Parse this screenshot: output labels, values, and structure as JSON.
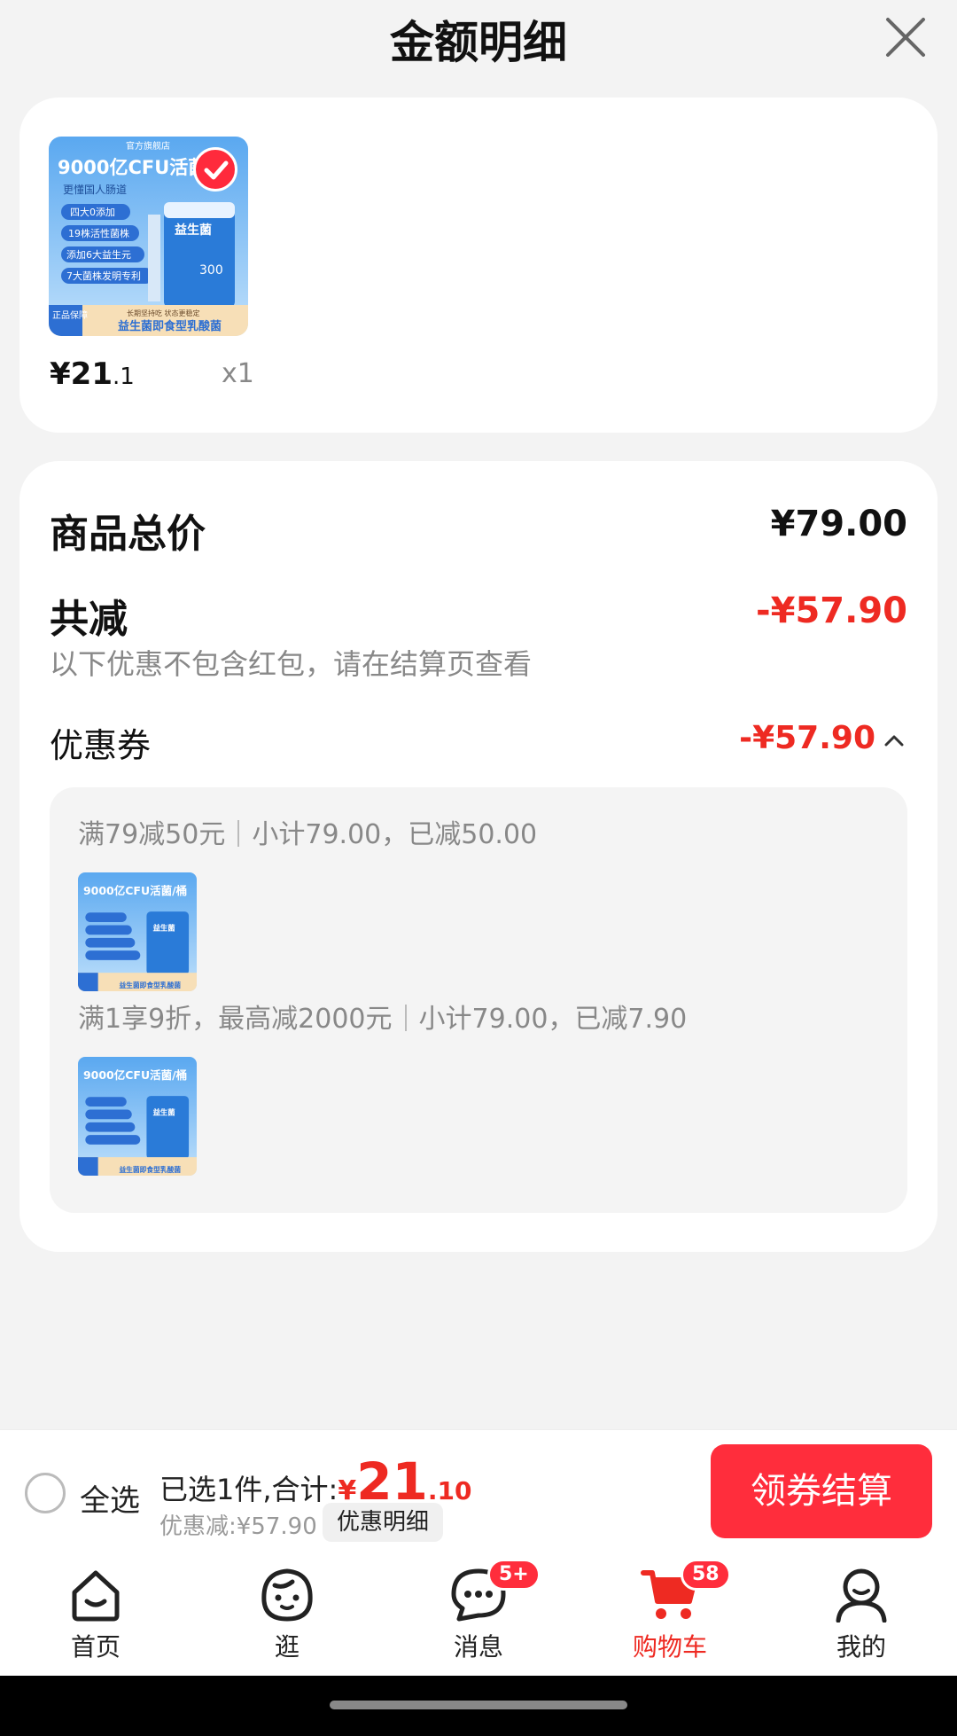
{
  "header": {
    "title": "金额明细"
  },
  "product": {
    "price_int": "¥21",
    "price_dec": ".1",
    "qty": "x1",
    "img": {
      "brand": "官方旗舰店",
      "headline": "9000亿CFU活菌/桶",
      "sub": "更懂国人肠道",
      "pills": [
        "四大0添加",
        "19株活性菌株",
        "添加6大益生元",
        "7大菌株发明专利"
      ],
      "can_text": "益生菌",
      "can_num": "300",
      "tag": "正品保障",
      "footer_small": "长期坚持吃 状态更稳定",
      "footer": "益生菌即食型乳酸菌"
    }
  },
  "summary": {
    "total_label": "商品总价",
    "total_value": "¥79.00",
    "reduce_label": "共减",
    "reduce_value": "-¥57.90",
    "note": "以下优惠不包含红包，请在结算页查看",
    "coupon_label": "优惠券",
    "coupon_value": "-¥57.90",
    "coupons": [
      {
        "rule": "满79减50元",
        "detail": "小计79.00，已减50.00"
      },
      {
        "rule": "满1享9折，最高减2000元",
        "detail": "小计79.00，已减7.90"
      }
    ]
  },
  "checkout": {
    "select_all": "全选",
    "selected_prefix": "已选1件,合计:",
    "currency": "¥",
    "total_int": "21",
    "total_dec": ".10",
    "discount": "优惠减:¥57.90",
    "detail_chip": "优惠明细",
    "button": "领券结算"
  },
  "tabs": [
    {
      "label": "首页",
      "icon": "home-icon"
    },
    {
      "label": "逛",
      "icon": "smile-face-icon"
    },
    {
      "label": "消息",
      "icon": "chat-bubble-icon",
      "badge": "5+"
    },
    {
      "label": "购物车",
      "icon": "cart-icon",
      "badge": "58",
      "active": true
    },
    {
      "label": "我的",
      "icon": "person-icon"
    }
  ],
  "colors": {
    "accent_red": "#ee2a22",
    "button_red": "#ff2d3c"
  }
}
